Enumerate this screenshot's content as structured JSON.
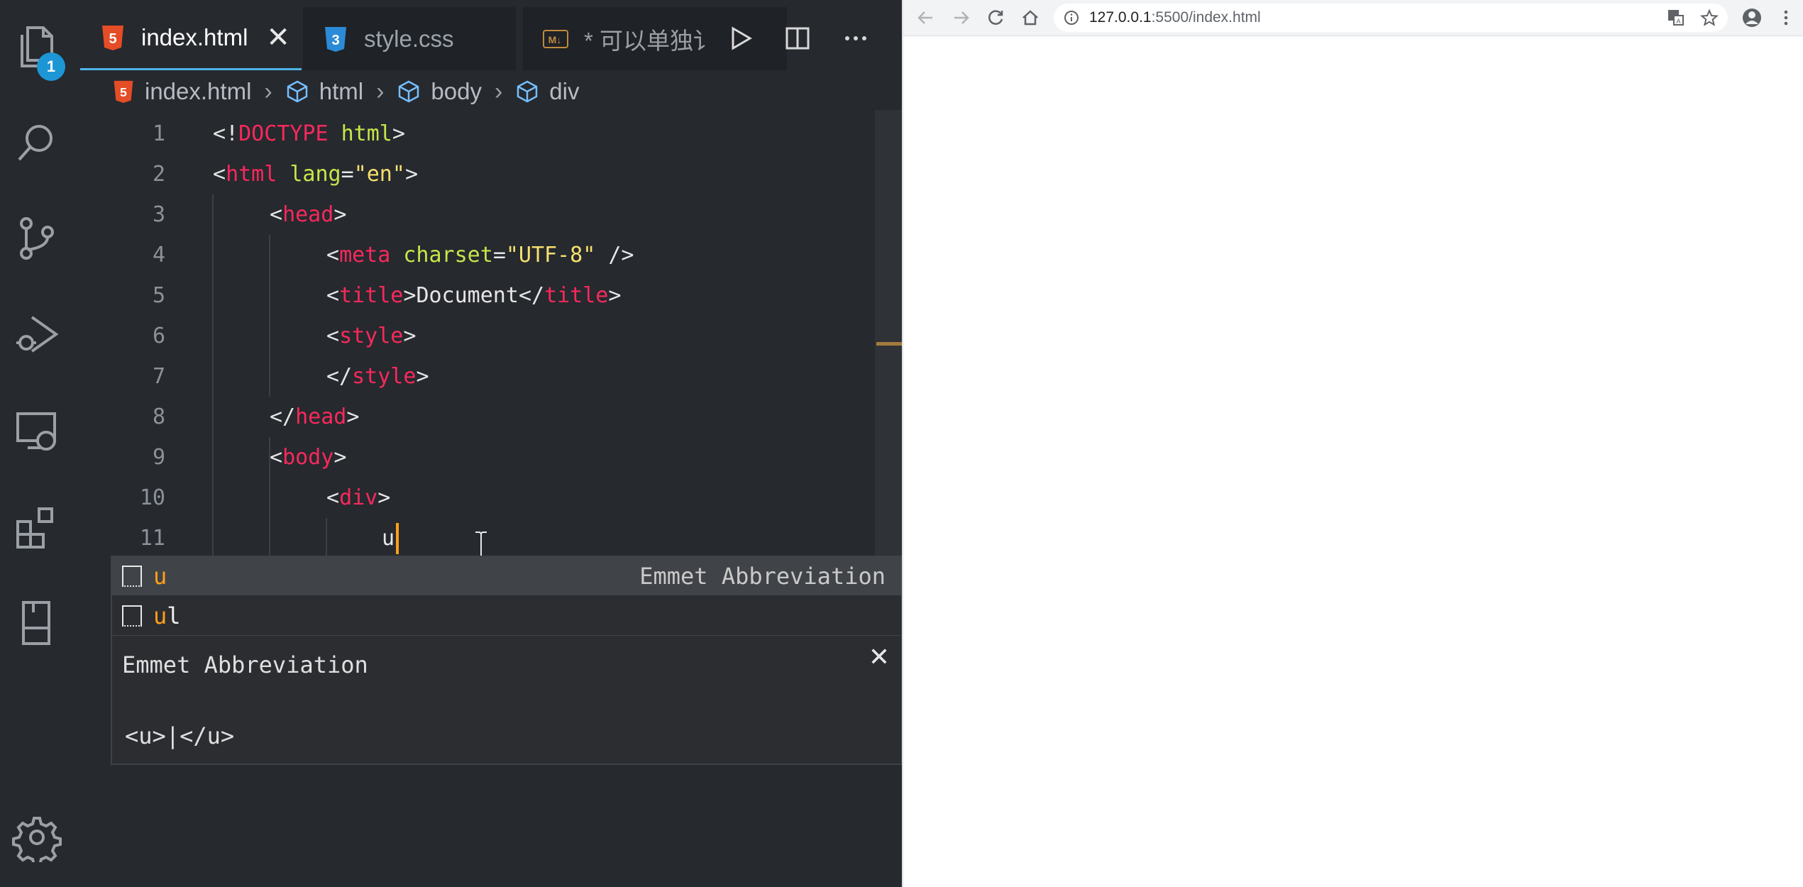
{
  "editor": {
    "activity_bar": {
      "explorer_badge": "1",
      "items": [
        "files-icon",
        "search-icon",
        "source-control-icon",
        "run-debug-icon",
        "remote-explorer-icon",
        "extensions-icon",
        "bookmark-icon",
        "settings-gear-icon"
      ]
    },
    "tabs": [
      {
        "label": "index.html",
        "icon": "html5-icon",
        "active": true
      },
      {
        "label": "style.css",
        "icon": "css3-icon",
        "active": false
      },
      {
        "label": "* 可以单独讠",
        "icon": "markdown-icon",
        "active": false
      }
    ],
    "tab_close": "✕",
    "tab_actions": [
      "run-icon",
      "split-editor-icon",
      "more-actions-icon"
    ],
    "breadcrumb": [
      "index.html",
      "html",
      "body",
      "div"
    ],
    "lines": [
      {
        "n": "1"
      },
      {
        "n": "2"
      },
      {
        "n": "3"
      },
      {
        "n": "4"
      },
      {
        "n": "5"
      },
      {
        "n": "6"
      },
      {
        "n": "7"
      },
      {
        "n": "8"
      },
      {
        "n": "9"
      },
      {
        "n": "10"
      },
      {
        "n": "11"
      }
    ],
    "code": {
      "l1": {
        "open": "<!",
        "doctype": "DOCTYPE",
        "sp": " ",
        "html": "html",
        "close": ">"
      },
      "l2": {
        "open": "<",
        "tag": "html",
        "sp": " ",
        "attr": "lang",
        "eq": "=",
        "val": "\"en\"",
        "close": ">"
      },
      "l3": {
        "open": "<",
        "tag": "head",
        "close": ">"
      },
      "l4": {
        "open": "<",
        "tag": "meta",
        "sp": " ",
        "attr": "charset",
        "eq": "=",
        "val": "\"UTF-8\"",
        "close": " />"
      },
      "l5": {
        "open": "<",
        "tag": "title",
        "close": ">",
        "text": "Document",
        "open2": "</",
        "tag2": "title",
        "close2": ">"
      },
      "l6": {
        "open": "<",
        "tag": "style",
        "close": ">"
      },
      "l7": {
        "open": "</",
        "tag": "style",
        "close": ">"
      },
      "l8": {
        "open": "</",
        "tag": "head",
        "close": ">"
      },
      "l9": {
        "open": "<",
        "tag": "body",
        "close": ">"
      },
      "l10": {
        "open": "<",
        "tag": "div",
        "close": ">"
      },
      "l11": {
        "text": "u"
      }
    },
    "suggest": {
      "items": [
        {
          "match": "u",
          "rest": "",
          "detail": "Emmet Abbreviation",
          "selected": true
        },
        {
          "match": "u",
          "rest": "l",
          "detail": "",
          "selected": false
        }
      ],
      "doc_title": "Emmet Abbreviation",
      "doc_code": "<u>|</u>",
      "doc_close": "✕"
    }
  },
  "browser": {
    "url_host": "127.0.0.1",
    "url_path": ":5500/index.html",
    "buttons": [
      "back-icon",
      "forward-icon",
      "reload-icon",
      "home-icon",
      "translate-icon",
      "bookmark-star-icon",
      "profile-icon",
      "menu-icon"
    ]
  },
  "colors": {
    "editor_bg": "#26292e",
    "tag": "#f7295c",
    "attr": "#c7e54a",
    "string": "#f5e06e",
    "cursor": "#ff9f1a",
    "tab_accent": "#4fb3e8",
    "badge": "#1d96d6"
  }
}
